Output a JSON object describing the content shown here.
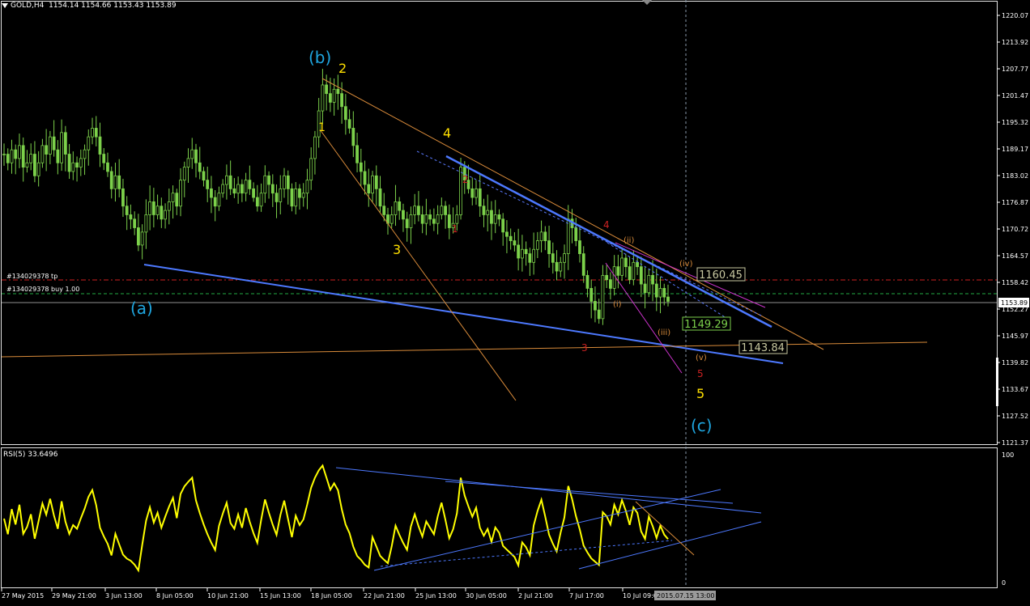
{
  "header": {
    "symbol": "GOLD,H4",
    "ohlc": "1154.14 1154.66 1153.43 1153.89"
  },
  "order_lines": {
    "tp_label": "#134029378 tp",
    "buy_label": "#134029378 buy 1.00"
  },
  "price_axis": {
    "ticks": [
      "1220.07",
      "1213.92",
      "1207.77",
      "1201.47",
      "1195.32",
      "1189.17",
      "1183.02",
      "1176.87",
      "1170.72",
      "1164.57",
      "1158.42",
      "1152.27",
      "1145.97",
      "1139.82",
      "1133.67",
      "1127.52",
      "1121.37"
    ],
    "current": "1153.89"
  },
  "rsi": {
    "label": "RSI(5) 33.6496",
    "axis_max": "100",
    "axis_min": "0"
  },
  "time_axis": {
    "labels": [
      "27 May 2015",
      "29 May 21:00",
      "3 Jun 13:00",
      "8 Jun 05:00",
      "10 Jun 21:00",
      "15 Jun 13:00",
      "18 Jun 05:00",
      "22 Jun 21:00",
      "25 Jun 13:00",
      "30 Jun 05:00",
      "2 Jul 21:00",
      "7 Jul 17:00",
      "10 Jul 09:00"
    ],
    "cursor_label": "2015.07.15 13:00"
  },
  "annotations": {
    "b_wave": "(b)",
    "a_wave": "(a)",
    "c_wave": "(c)",
    "y1": "1",
    "y2": "2",
    "y3": "3",
    "y4": "4",
    "y5": "5",
    "r1": "1",
    "r2": "2",
    "r3": "3",
    "r4": "4",
    "r5": "5",
    "o_i": "(i)",
    "o_ii": "(ii)",
    "o_iii": "(iii)",
    "o_iv": "(iv)",
    "o_v": "(v)",
    "box1": "1160.45",
    "box2": "1149.29",
    "box3": "1143.84"
  },
  "colors": {
    "candle": "#7cd14b",
    "rsi": "#ffff00",
    "trend": "#4d79ff",
    "orange": "#d98b3a",
    "magenta": "#cc33cc",
    "cyan": "#1fa6e0",
    "yellow": "#ffe000",
    "red": "#cc2222"
  },
  "chart_data": {
    "type": "candlestick",
    "price_range": [
      1121.37,
      1220.07
    ],
    "close_path": [
      1188,
      1186,
      1189,
      1187,
      1190,
      1185,
      1186,
      1188,
      1183,
      1186,
      1190,
      1188,
      1192,
      1189,
      1186,
      1193,
      1188,
      1184,
      1186,
      1185,
      1187,
      1189,
      1192,
      1194,
      1192,
      1188,
      1186,
      1184,
      1180,
      1183,
      1180,
      1176,
      1174,
      1173,
      1171,
      1167,
      1170,
      1174,
      1177,
      1174,
      1176,
      1173,
      1175,
      1177,
      1179,
      1176,
      1182,
      1185,
      1187,
      1189,
      1186,
      1184,
      1182,
      1180,
      1178,
      1176,
      1179,
      1181,
      1183,
      1180,
      1179,
      1181,
      1179,
      1182,
      1180,
      1178,
      1176,
      1179,
      1183,
      1181,
      1179,
      1177,
      1180,
      1183,
      1180,
      1176,
      1180,
      1178,
      1179,
      1182,
      1187,
      1192,
      1198,
      1204,
      1202,
      1200,
      1203,
      1202,
      1199,
      1196,
      1194,
      1190,
      1186,
      1184,
      1181,
      1179,
      1183,
      1180,
      1176,
      1174,
      1172,
      1174,
      1177,
      1175,
      1173,
      1171,
      1174,
      1176,
      1174,
      1172,
      1174,
      1173,
      1172,
      1174,
      1176,
      1174,
      1171,
      1172,
      1174,
      1185,
      1182,
      1180,
      1178,
      1180,
      1176,
      1174,
      1175,
      1172,
      1174,
      1173,
      1170,
      1169,
      1168,
      1167,
      1164,
      1166,
      1165,
      1163,
      1166,
      1168,
      1170,
      1168,
      1165,
      1163,
      1161,
      1163,
      1165,
      1173,
      1171,
      1168,
      1165,
      1160,
      1157,
      1154,
      1152,
      1150,
      1160,
      1159,
      1157,
      1162,
      1160,
      1164,
      1162,
      1159,
      1163,
      1162,
      1158,
      1156,
      1160,
      1158,
      1155,
      1157,
      1155,
      1154
    ]
  }
}
